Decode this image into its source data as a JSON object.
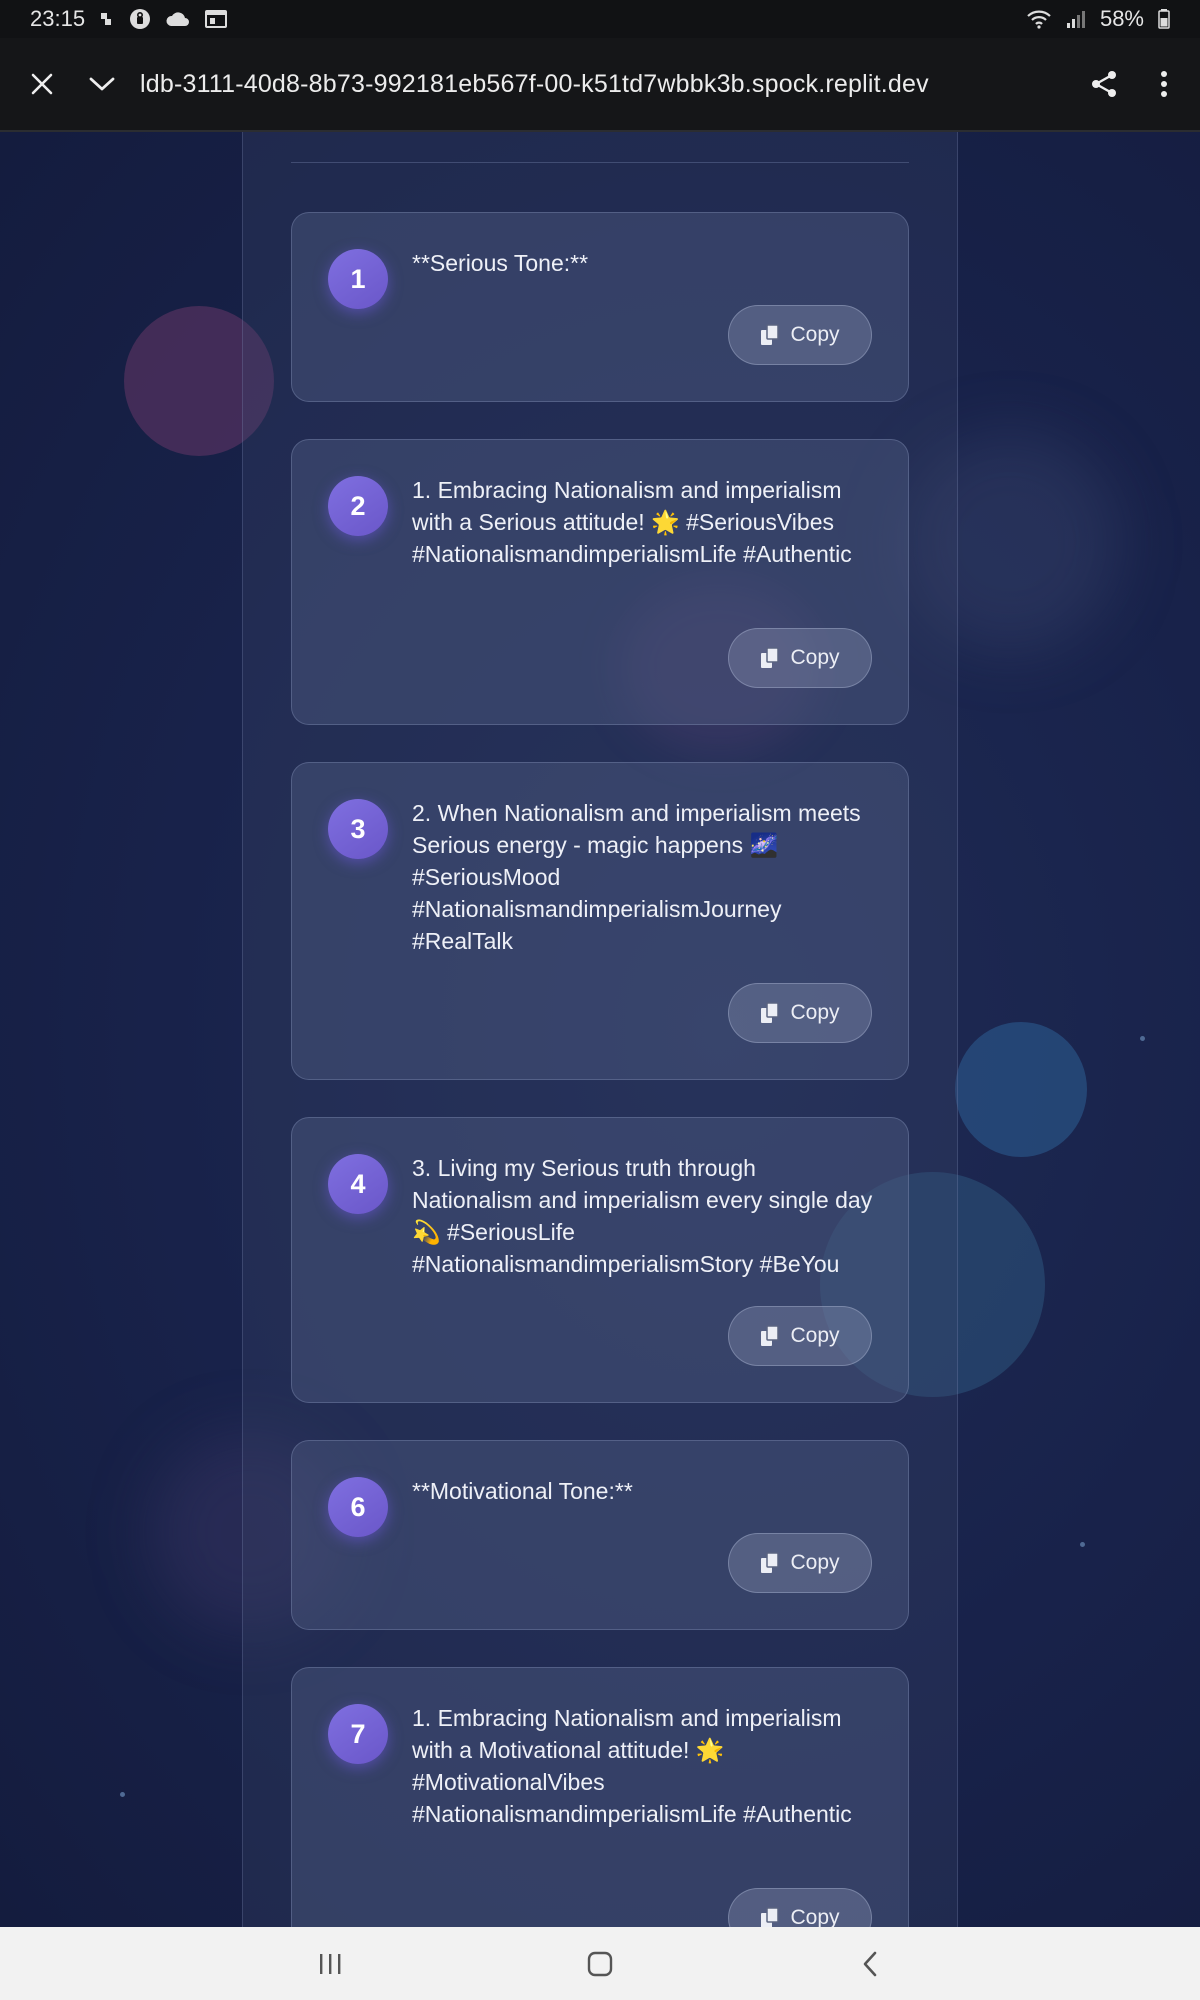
{
  "status_bar": {
    "time": "23:15",
    "battery": "58%",
    "icons_left": [
      "notification-dot-icon",
      "privacy-icon",
      "cloud-icon",
      "screen-icon"
    ],
    "icons_right": [
      "wifi-icon",
      "signal-icon",
      "battery-icon"
    ]
  },
  "browser": {
    "url": "ldb-3111-40d8-8b73-992181eb567f-00-k51td7wbbk3b.spock.replit.dev",
    "close_icon": "close-icon",
    "collapse_icon": "chevron-down-icon",
    "share_icon": "share-icon",
    "menu_icon": "more-vert-icon"
  },
  "cards": [
    {
      "number": "1",
      "text": "**Serious Tone:**",
      "copy_label": "Copy"
    },
    {
      "number": "2",
      "text": "1. Embracing Nationalism and imperialism with a Serious attitude! 🌟 #SeriousVibes #NationalismandimperialismLife #Authentic",
      "copy_label": "Copy"
    },
    {
      "number": "3",
      "text": "2. When Nationalism and imperialism meets Serious energy - magic happens 🌌 #SeriousMood #NationalismandimperialismJourney #RealTalk",
      "copy_label": "Copy"
    },
    {
      "number": "4",
      "text": "3. Living my Serious truth through Nationalism and imperialism every single day 💫 #SeriousLife #NationalismandimperialismStory #BeYou",
      "copy_label": "Copy"
    },
    {
      "number": "6",
      "text": "**Motivational Tone:**",
      "copy_label": "Copy"
    },
    {
      "number": "7",
      "text": "1. Embracing Nationalism and imperialism with a Motivational attitude! 🌟 #MotivationalVibes #NationalismandimperialismLife #Authentic",
      "copy_label": "Copy"
    }
  ],
  "colors": {
    "badge": "#7262d6",
    "page_bg": "#1a2447"
  }
}
